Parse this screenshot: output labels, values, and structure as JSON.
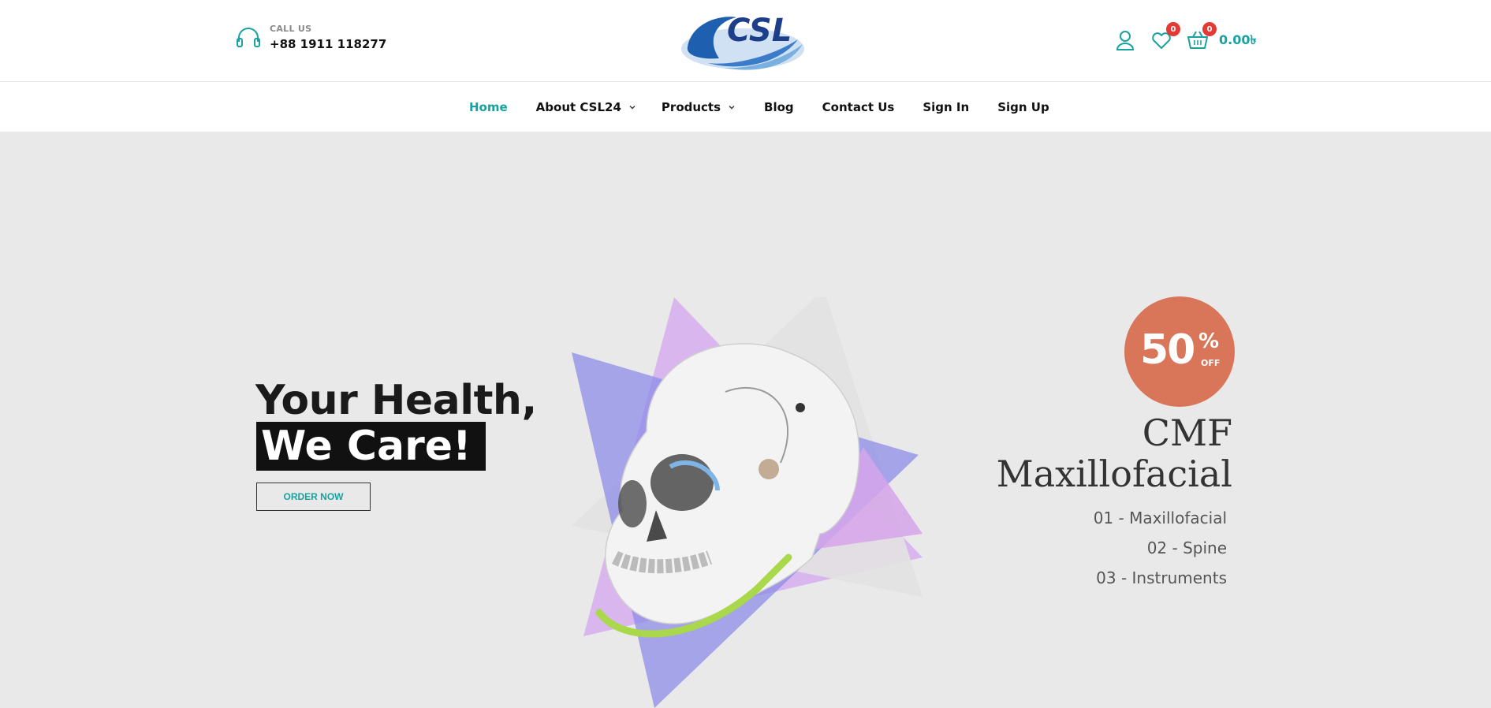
{
  "header": {
    "call_label": "CALL US",
    "phone": "+88 1911 118277",
    "logo_text": "CSL",
    "wishlist_count": "0",
    "cart_count": "0",
    "cart_total": "0.00৳"
  },
  "nav": {
    "items": [
      {
        "label": "Home",
        "active": true
      },
      {
        "label": "About CSL24",
        "dropdown": true
      },
      {
        "label": "Products",
        "dropdown": true
      },
      {
        "label": "Blog"
      },
      {
        "label": "Contact Us"
      },
      {
        "label": "Sign In"
      },
      {
        "label": "Sign Up"
      }
    ]
  },
  "hero": {
    "headline_line1": "Your Health,",
    "headline_line2": "We Care!",
    "cta_label": "ORDER NOW",
    "sale_number": "50",
    "sale_percent": "%",
    "sale_off": "OFF",
    "promo_title_line1": "CMF",
    "promo_title_line2": "Maxillofacial",
    "categories": [
      "01 - Maxillofacial",
      "02 - Spine",
      "03 - Instruments"
    ]
  },
  "colors": {
    "accent": "#17a2a2",
    "badge": "#e53935",
    "sale_circle": "#d97559",
    "hero_bg": "#e9e9e9",
    "logo_blue": "#1f5fb0"
  },
  "icons": [
    "headset-icon",
    "user-icon",
    "heart-icon",
    "cart-icon",
    "chevron-down-icon"
  ]
}
